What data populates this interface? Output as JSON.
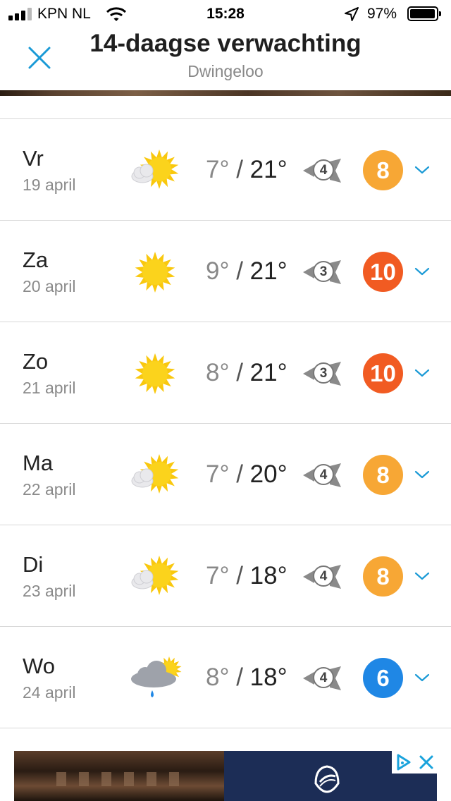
{
  "status_bar": {
    "carrier": "KPN NL",
    "time": "15:28",
    "battery": "97%",
    "signal_bars": 3
  },
  "header": {
    "title": "14-daagse verwachting",
    "subtitle": "Dwingeloo",
    "close_icon": "close-icon",
    "accent": "#1a9ad6"
  },
  "forecast": [
    {
      "day": "Vr",
      "date": "19 april",
      "weather": "sun-behind-cloud",
      "min": "7°",
      "max": "21°",
      "wind": "4",
      "score": "8",
      "score_color": "#f7a735"
    },
    {
      "day": "Za",
      "date": "20 april",
      "weather": "sun",
      "min": "9°",
      "max": "21°",
      "wind": "3",
      "score": "10",
      "score_color": "#f15b22"
    },
    {
      "day": "Zo",
      "date": "21 april",
      "weather": "sun",
      "min": "8°",
      "max": "21°",
      "wind": "3",
      "score": "10",
      "score_color": "#f15b22"
    },
    {
      "day": "Ma",
      "date": "22 april",
      "weather": "sun-behind-cloud",
      "min": "7°",
      "max": "20°",
      "wind": "4",
      "score": "8",
      "score_color": "#f7a735"
    },
    {
      "day": "Di",
      "date": "23 april",
      "weather": "sun-behind-cloud",
      "min": "7°",
      "max": "18°",
      "wind": "4",
      "score": "8",
      "score_color": "#f7a735"
    },
    {
      "day": "Wo",
      "date": "24 april",
      "weather": "cloud-rain-sun",
      "min": "8°",
      "max": "18°",
      "wind": "4",
      "score": "6",
      "score_color": "#1f87e5"
    }
  ],
  "temp_separator": "/"
}
